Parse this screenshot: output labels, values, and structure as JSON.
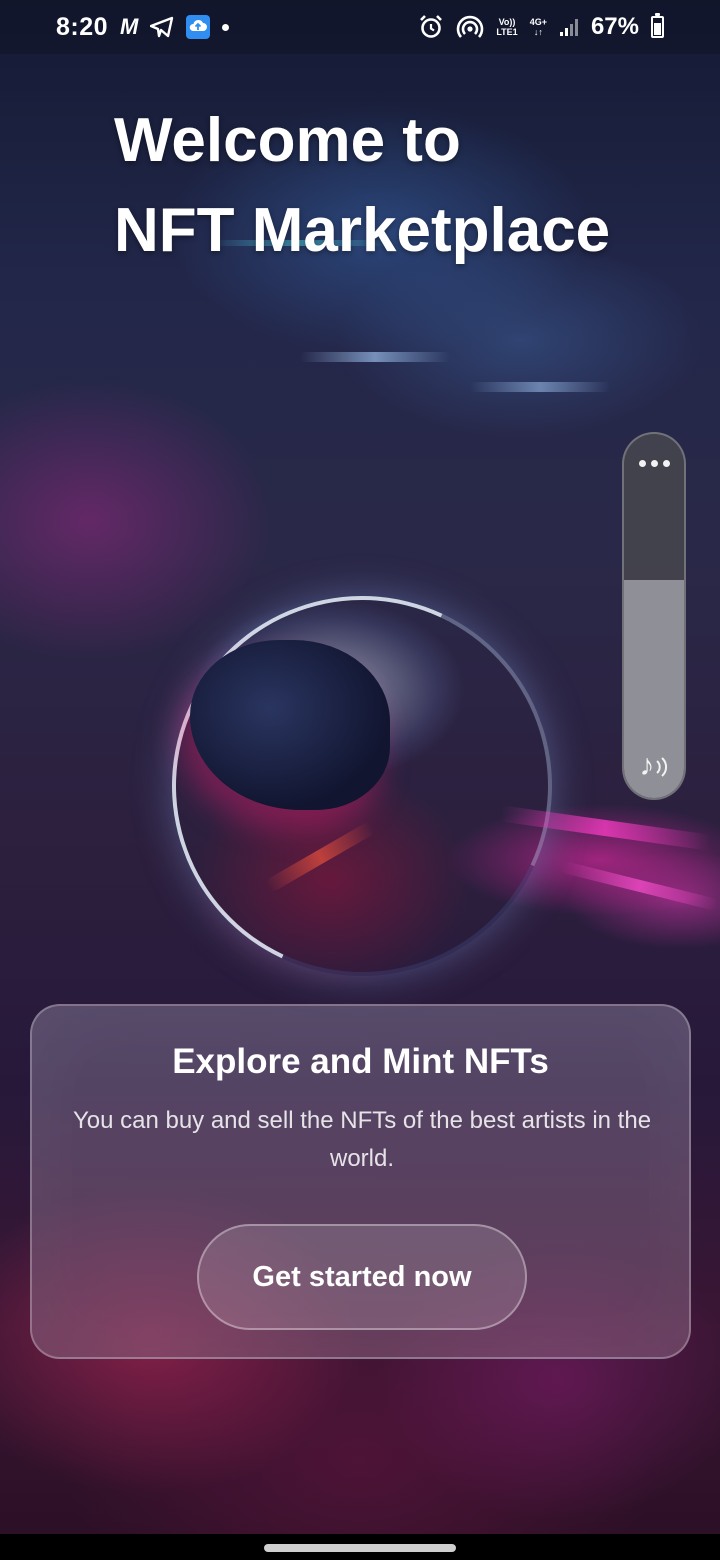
{
  "status_bar": {
    "time": "8:20",
    "icons_left": [
      "m-icon",
      "telegram-icon",
      "cloud-upload-icon",
      "notification-dot-icon"
    ],
    "m_glyph": "M",
    "network_top": "Vo))",
    "network_bottom": "LTE1",
    "net_type_top": "4G+",
    "net_type_bottom": "↓↑",
    "icons_right": [
      "alarm-icon",
      "hotspot-icon",
      "volte-icon",
      "4g-plus-icon",
      "signal-icon",
      "battery-icon"
    ],
    "battery_percent": "67%",
    "battery_level": 0.67
  },
  "headline": {
    "line1": "Welcome to",
    "line2": "NFT Marketplace"
  },
  "volume_panel": {
    "more_icon": "more-dots-icon",
    "level": 0.6,
    "speaker_icon": "music-volume-icon",
    "speaker_glyph": "♪"
  },
  "card": {
    "title": "Explore and Mint NFTs",
    "description": "You can buy and sell the NFTs of the best artists in the world.",
    "cta_label": "Get started now"
  },
  "colors": {
    "cloud_icon": "#2f8ef0",
    "card_border": "rgba(255,255,255,0.28)"
  }
}
